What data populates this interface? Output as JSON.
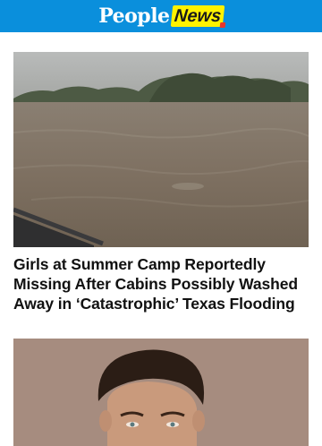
{
  "header": {
    "logo_people": "People",
    "logo_news": "News",
    "bg_color": "#0a8fdc",
    "news_badge_color": "#fff200"
  },
  "stories": [
    {
      "headline": "Girls at Summer Camp Reportedly Missing After Cabins Possibly Washed Away in ‘Catastrophic’ Texas Flooding",
      "image": "flooded-river-photo"
    },
    {
      "headline": "",
      "image": "man-portrait-photo"
    }
  ]
}
